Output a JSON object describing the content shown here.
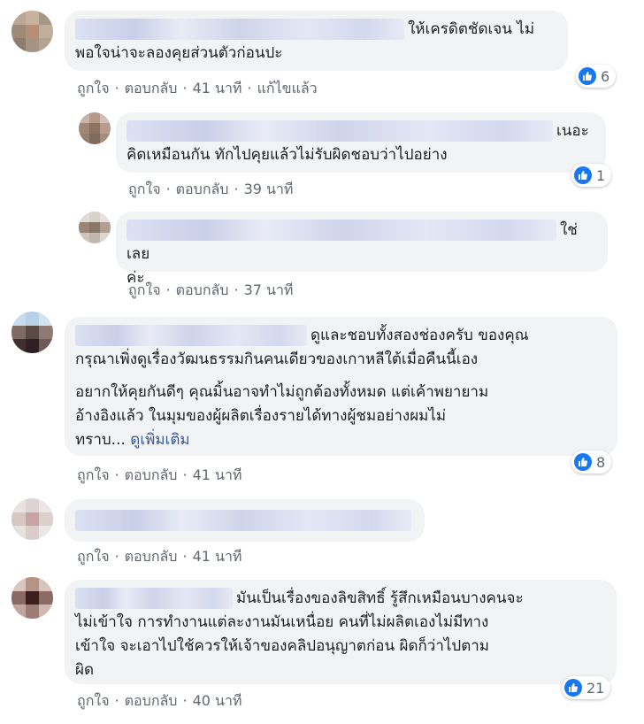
{
  "labels": {
    "like": "ถูกใจ",
    "reply": "ตอบกลับ",
    "edited": "แก้ไขแล้ว",
    "see_more": "ดูเพิ่มเติม"
  },
  "colors": {
    "bubble": "#f2f3f5",
    "like_blue": "#1877f2",
    "link": "#385898",
    "meta": "#606770"
  },
  "comments": [
    {
      "lines": [
        "ให้เครดิตชัดเจน ไม่",
        "พอใจน่าจะลองคุยส่วนตัวก่อนปะ"
      ],
      "time": "41 นาที",
      "reactions": "6"
    },
    {
      "lines": [
        "เนอะ",
        "คิดเหมือนกัน ทักไปคุยแล้วไม่รับผิดชอบว่าไปอย่าง"
      ],
      "time": "39 นาที",
      "reactions": "1"
    },
    {
      "lines": [
        "ใช่เลย",
        "ค่ะ"
      ],
      "time": "37 นาที",
      "reactions": ""
    },
    {
      "para1": [
        "ดูและชอบทั้งสองช่องครับ ของคุณ",
        "กรุณาเพิ่งดูเรื่องวัฒนธรรมกินคนเดียวของเกาหลีใต้เมื่อคืนนี้เอง"
      ],
      "para2": [
        "อยากให้คุยกันดีๆ คุณมิ้นอาจทำไม่ถูกต้องทั้งหมด แต่เค้าพยายาม",
        "อ้างอิงแล้ว ในมุมของผู้ผลิตเรื่องรายได้ทางผู้ชมอย่างผมไม่",
        "ทราบ..."
      ],
      "time": "41 นาที",
      "reactions": "8"
    },
    {
      "lines": [],
      "time": "41 นาที",
      "reactions": ""
    },
    {
      "lines": [
        "มันเป็นเรื่องของลิขสิทธิ์ รู้สึกเหมือนบางคนจะ",
        "ไม่เข้าใจ การทำงานแต่ละงานมันเหนื่อย คนที่ไม่ผลิตเองไม่มีทาง",
        "เข้าใจ จะเอาไปใช้ควรให้เจ้าของคลิปอนุญาตก่อน ผิดก็ว่าไปตาม",
        "ผิด"
      ],
      "time": "40 นาที",
      "reactions": "21"
    }
  ]
}
